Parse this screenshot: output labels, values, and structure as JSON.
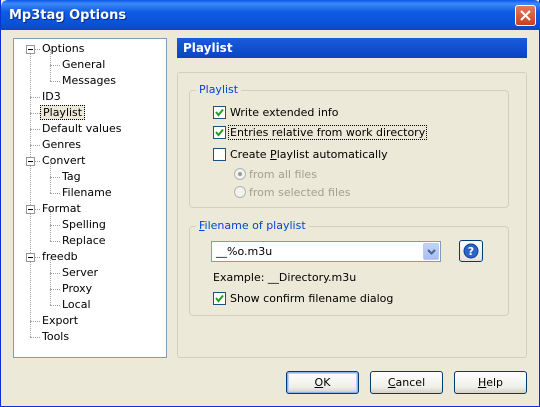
{
  "window": {
    "title": "Mp3tag Options"
  },
  "tree": {
    "items": [
      {
        "label": "Options",
        "level": 0,
        "expandable": true
      },
      {
        "label": "General",
        "level": 1
      },
      {
        "label": "Messages",
        "level": 1
      },
      {
        "label": "ID3",
        "level": 0
      },
      {
        "label": "Playlist",
        "level": 0,
        "selected": true
      },
      {
        "label": "Default values",
        "level": 0
      },
      {
        "label": "Genres",
        "level": 0
      },
      {
        "label": "Convert",
        "level": 0,
        "expandable": true
      },
      {
        "label": "Tag",
        "level": 1
      },
      {
        "label": "Filename",
        "level": 1
      },
      {
        "label": "Format",
        "level": 0,
        "expandable": true
      },
      {
        "label": "Spelling",
        "level": 1
      },
      {
        "label": "Replace",
        "level": 1
      },
      {
        "label": "freedb",
        "level": 0,
        "expandable": true
      },
      {
        "label": "Server",
        "level": 1
      },
      {
        "label": "Proxy",
        "level": 1
      },
      {
        "label": "Local",
        "level": 1
      },
      {
        "label": "Export",
        "level": 0
      },
      {
        "label": "Tools",
        "level": 0
      }
    ]
  },
  "page": {
    "header": "Playlist"
  },
  "playlist_group": {
    "title": "Playlist",
    "write_extended": {
      "label": "Write extended info",
      "checked": true
    },
    "relative_entries": {
      "label": "Entries relative from work directory",
      "checked": true
    },
    "create_auto": {
      "label_pre": "Create ",
      "label_accel": "P",
      "label_post": "laylist automatically",
      "checked": false
    },
    "from_all": {
      "label": "from all files",
      "checked": true,
      "enabled": false
    },
    "from_selected": {
      "label": "from selected files",
      "checked": false,
      "enabled": false
    }
  },
  "filename_group": {
    "title_accel": "F",
    "title_rest": "ilename of playlist",
    "combo_value": "__%o.m3u",
    "example": "Example:  __Directory.m3u",
    "show_confirm": {
      "label": "Show confirm filename dialog",
      "checked": true
    }
  },
  "buttons": {
    "ok_accel": "O",
    "ok_rest": "K",
    "cancel_accel": "C",
    "cancel_rest": "ancel",
    "help_accel": "H",
    "help_rest": "elp"
  },
  "colors": {
    "accent": "#0a44c0",
    "group_title": "#0046d5"
  }
}
